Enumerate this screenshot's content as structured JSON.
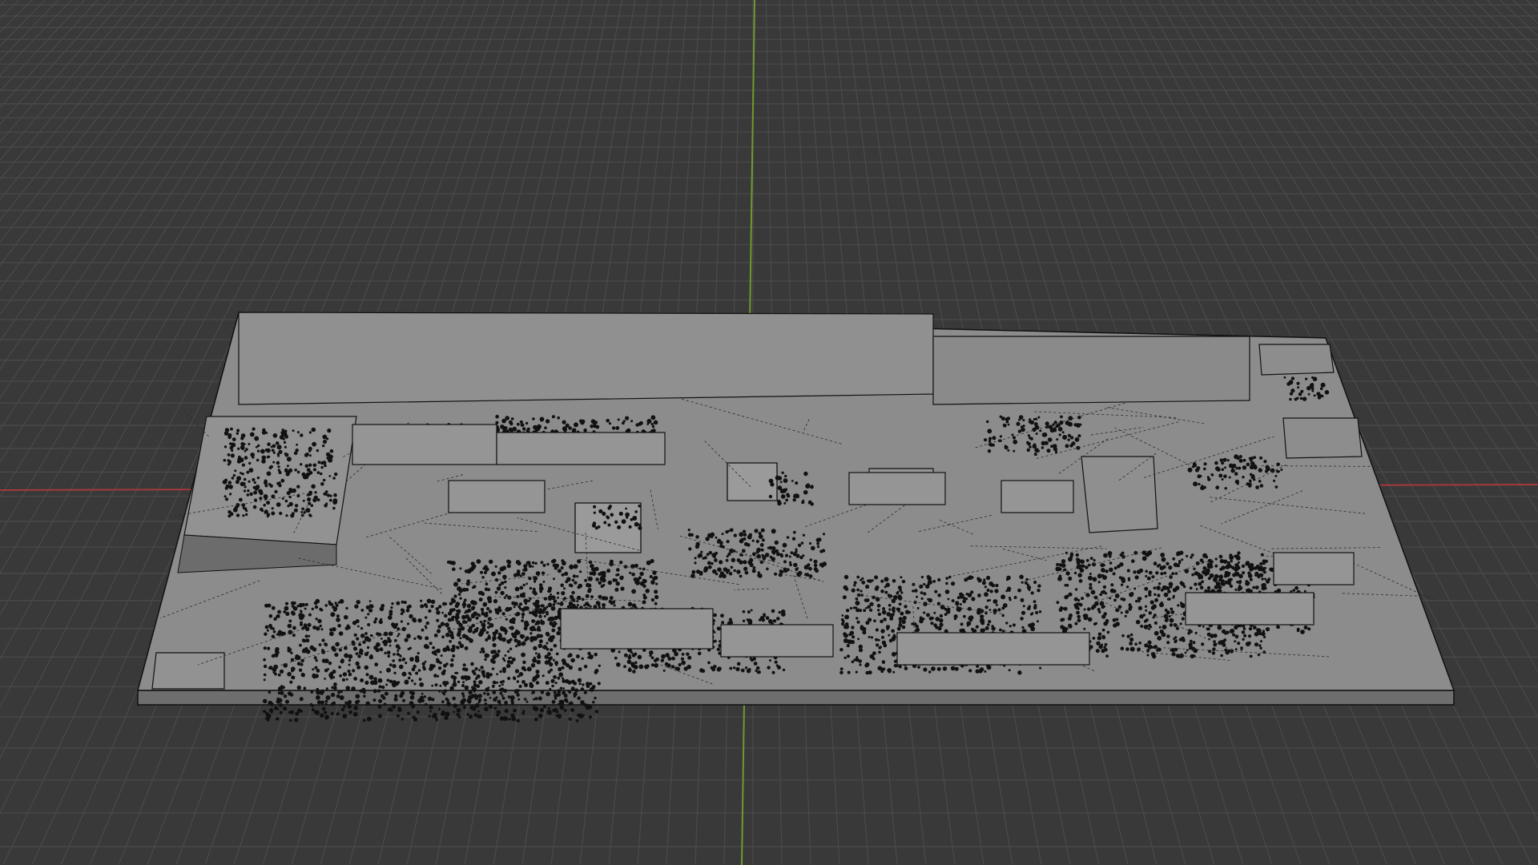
{
  "app": "3D Viewport",
  "viewport": {
    "background_color": "#393939",
    "grid_color": "#4a4a4a",
    "x_axis_color": "#a33a3a",
    "y_axis_color": "#6f9a2e",
    "object_fill": "#8f8f8f",
    "object_side": "#6e6e6e",
    "wire_color": "#111111",
    "object_name": ""
  }
}
